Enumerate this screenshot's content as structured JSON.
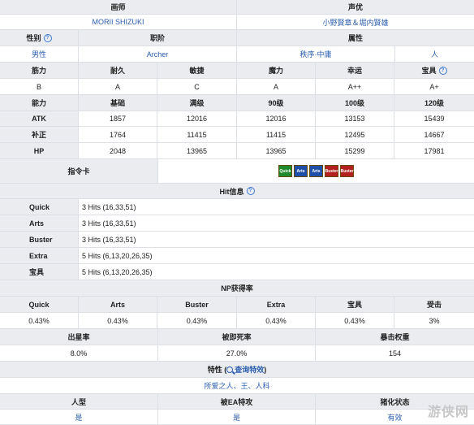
{
  "illustrator": {
    "label": "画师",
    "value": "MORII SHIZUKI"
  },
  "voice_actor": {
    "label": "声优",
    "value": "小野賢章＆堀内賢雄"
  },
  "attributes_header": {
    "gender": "性别",
    "class": "职阶",
    "attribute": "属性"
  },
  "attributes_values": {
    "gender": "男性",
    "class": "Archer",
    "alignment": "秩序·中庸",
    "attribute": "人"
  },
  "parameters": {
    "headers": [
      "筋力",
      "耐久",
      "敏捷",
      "魔力",
      "幸运",
      "宝具"
    ],
    "values": [
      "B",
      "A",
      "C",
      "A",
      "A++",
      "A+"
    ]
  },
  "stats": {
    "headers": [
      "能力",
      "基础",
      "满级",
      "90级",
      "100级",
      "120级"
    ],
    "rows": [
      {
        "label": "ATK",
        "values": [
          "1857",
          "12016",
          "12016",
          "13153",
          "15439"
        ]
      },
      {
        "label": "补正",
        "values": [
          "1764",
          "11415",
          "11415",
          "12495",
          "14667"
        ]
      },
      {
        "label": "HP",
        "values": [
          "2048",
          "13965",
          "13965",
          "15299",
          "17981"
        ]
      }
    ]
  },
  "command_cards": {
    "label": "指令卡",
    "cards": [
      "Quick",
      "Arts",
      "Arts",
      "Buster",
      "Buster"
    ]
  },
  "hit_info": {
    "title": "Hit信息",
    "rows": [
      {
        "label": "Quick",
        "value": "3 Hits (16,33,51)"
      },
      {
        "label": "Arts",
        "value": "3 Hits (16,33,51)"
      },
      {
        "label": "Buster",
        "value": "3 Hits (16,33,51)"
      },
      {
        "label": "Extra",
        "value": "5 Hits (6,13,20,26,35)"
      },
      {
        "label": "宝具",
        "value": "5 Hits (6,13,20,26,35)"
      }
    ]
  },
  "np": {
    "title": "NP获得率",
    "headers": [
      "Quick",
      "Arts",
      "Buster",
      "Extra",
      "宝具",
      "受击"
    ],
    "values": [
      "0.43%",
      "0.43%",
      "0.43%",
      "0.43%",
      "0.43%",
      "3%"
    ]
  },
  "star": {
    "headers": [
      "出星率",
      "被即死率",
      "暴击权重"
    ],
    "values": [
      "8.0%",
      "27.0%",
      "154"
    ]
  },
  "traits": {
    "title_prefix": "特性 (",
    "link": "查询特效",
    "title_suffix": ")",
    "value": "所爱之人、王、人科"
  },
  "bottom": {
    "headers": [
      "人型",
      "被EA特攻",
      "猪化状态"
    ],
    "values": [
      "是",
      "是",
      "有效"
    ]
  },
  "watermark": "游侠网",
  "colors": {
    "header_bg": "#eaecf0",
    "link": "#2a5db0",
    "border": "#dcdfe6"
  }
}
